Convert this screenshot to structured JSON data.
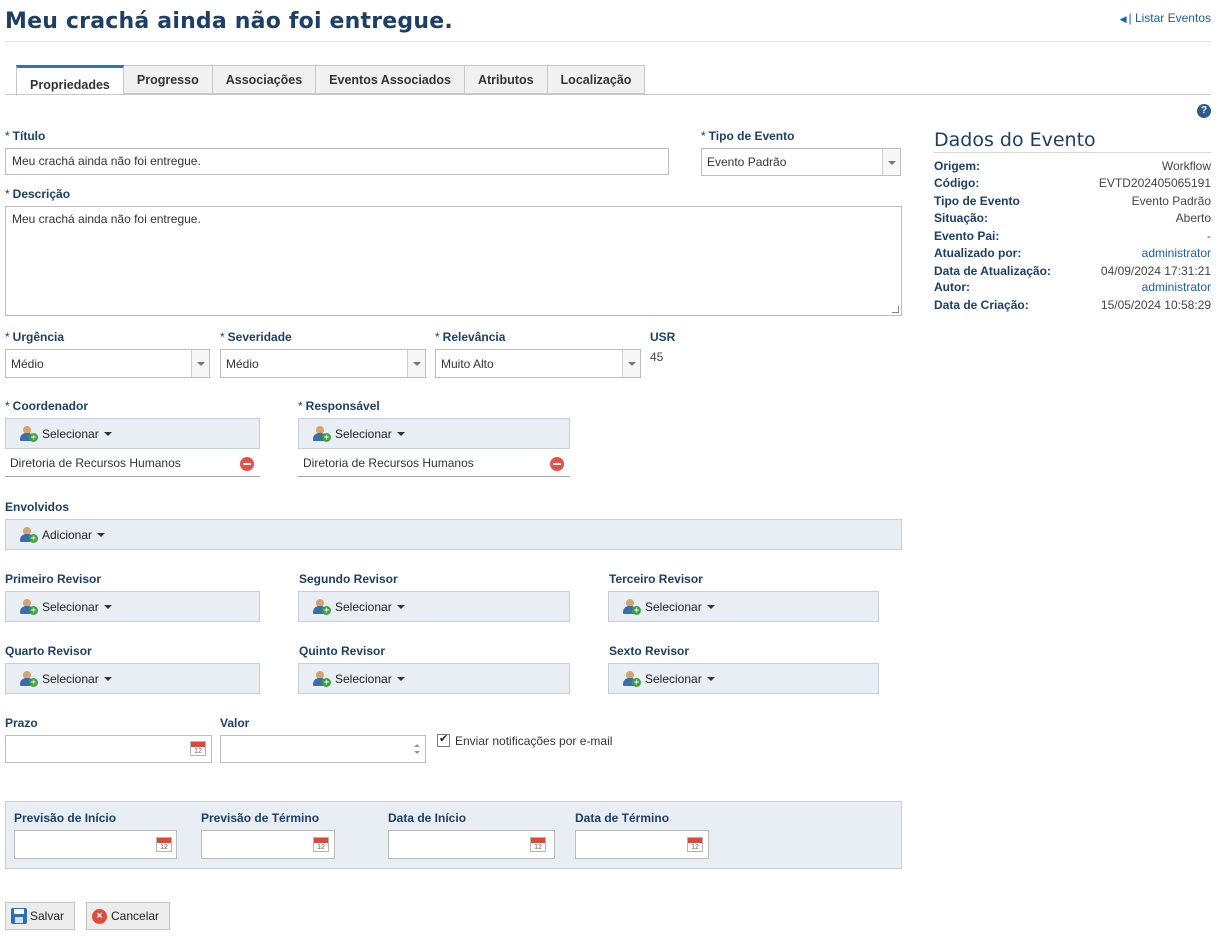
{
  "header": {
    "title": "Meu crachá ainda não foi entregue.",
    "list_link": "| Listar Eventos"
  },
  "tabs": [
    {
      "label": "Propriedades",
      "active": true
    },
    {
      "label": "Progresso"
    },
    {
      "label": "Associações"
    },
    {
      "label": "Eventos Associados"
    },
    {
      "label": "Atributos"
    },
    {
      "label": "Localização"
    }
  ],
  "form": {
    "titulo": {
      "label": "Título",
      "value": "Meu crachá ainda não foi entregue."
    },
    "tipo_evento": {
      "label": "Tipo de Evento",
      "value": "Evento Padrão"
    },
    "descricao": {
      "label": "Descrição",
      "value": "Meu crachá ainda não foi entregue."
    },
    "urgencia": {
      "label": "Urgência",
      "value": "Médio"
    },
    "severidade": {
      "label": "Severidade",
      "value": "Médio"
    },
    "relevancia": {
      "label": "Relevância",
      "value": "Muito Alto"
    },
    "usr": {
      "label": "USR",
      "value": "45"
    },
    "coordenador": {
      "label": "Coordenador",
      "button": "Selecionar",
      "assigned": "Diretoria de Recursos Humanos"
    },
    "responsavel": {
      "label": "Responsável",
      "button": "Selecionar",
      "assigned": "Diretoria de Recursos Humanos"
    },
    "envolvidos": {
      "label": "Envolvidos",
      "button": "Adicionar"
    },
    "revisores": [
      {
        "label": "Primeiro Revisor",
        "button": "Selecionar"
      },
      {
        "label": "Segundo Revisor",
        "button": "Selecionar"
      },
      {
        "label": "Terceiro Revisor",
        "button": "Selecionar"
      },
      {
        "label": "Quarto Revisor",
        "button": "Selecionar"
      },
      {
        "label": "Quinto Revisor",
        "button": "Selecionar"
      },
      {
        "label": "Sexto Revisor",
        "button": "Selecionar"
      }
    ],
    "prazo": {
      "label": "Prazo",
      "value": ""
    },
    "valor": {
      "label": "Valor",
      "value": ""
    },
    "notificacoes": {
      "label": "Enviar notificações por e-mail",
      "checked": true
    },
    "datas": [
      {
        "label": "Previsão de Início",
        "value": ""
      },
      {
        "label": "Previsão de Término",
        "value": ""
      },
      {
        "label": "Data de Início",
        "value": ""
      },
      {
        "label": "Data de Término",
        "value": ""
      }
    ],
    "calendar_day": "12",
    "required_mark": "*"
  },
  "actions": {
    "save": "Salvar",
    "cancel": "Cancelar"
  },
  "dados_evento": {
    "title": "Dados do Evento",
    "rows": [
      {
        "key": "Origem:",
        "value": "Workflow"
      },
      {
        "key": "Código:",
        "value": "EVTD202405065191"
      },
      {
        "key": "Tipo de Evento",
        "value": "Evento Padrão"
      },
      {
        "key": "Situação:",
        "value": "Aberto"
      },
      {
        "key": "Evento Pai:",
        "value": "-"
      },
      {
        "key": "Atualizado por:",
        "value": "administrator"
      },
      {
        "key": "Data de Atualização:",
        "value": "04/09/2024 17:31:21"
      },
      {
        "key": "Autor:",
        "value": "administrator"
      },
      {
        "key": "Data de Criação:",
        "value": "15/05/2024 10:58:29"
      }
    ]
  },
  "icons": {
    "help": "help-icon",
    "user_add": "user-add-icon",
    "remove": "remove-icon",
    "calendar": "calendar-icon",
    "save": "save-icon",
    "cancel": "cancel-icon"
  },
  "colors": {
    "title": "#1d3f66",
    "accent": "#2e75b6",
    "link": "#1a5fa8",
    "picker_bg": "#e9edf4"
  }
}
